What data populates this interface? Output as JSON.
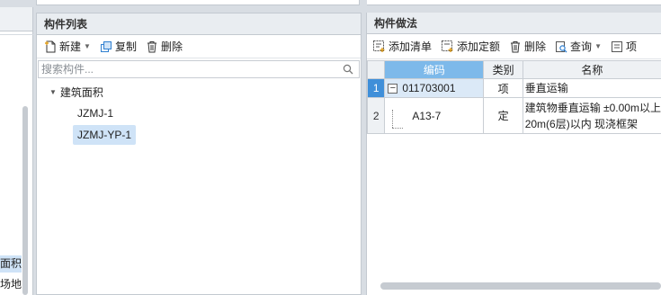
{
  "left_panel": {
    "items": [
      {
        "label": "面积",
        "selected": true
      },
      {
        "label": "场地",
        "selected": false
      }
    ]
  },
  "component_list": {
    "title": "构件列表",
    "toolbar": {
      "new_label": "新建",
      "copy_label": "复制",
      "delete_label": "删除"
    },
    "search": {
      "placeholder": "搜索构件...",
      "value": ""
    },
    "tree": {
      "root_label": "建筑面积",
      "children": [
        {
          "label": "JZMJ-1",
          "selected": false
        },
        {
          "label": "JZMJ-YP-1",
          "selected": true
        }
      ]
    }
  },
  "component_method": {
    "title": "构件做法",
    "toolbar": {
      "add_list_label": "添加清单",
      "add_quota_label": "添加定额",
      "delete_label": "删除",
      "query_label": "查询",
      "more_label": "项"
    },
    "table": {
      "headers": {
        "rownum": "",
        "code": "编码",
        "type": "类别",
        "name": "名称"
      },
      "rows": [
        {
          "num": "1",
          "code": "011703001",
          "type": "项",
          "name": "垂直运输"
        },
        {
          "num": "2",
          "code": "A13-7",
          "type": "定",
          "name_line1": "建筑物垂直运输 ±0.00m以上",
          "name_line2": "20m(6层)以内 现浇框架"
        }
      ]
    }
  },
  "colors": {
    "accent": "#3f8fd9",
    "header_active": "#7db9ea",
    "selection": "#cfe3f7",
    "panel_header": "#e9edf1"
  }
}
